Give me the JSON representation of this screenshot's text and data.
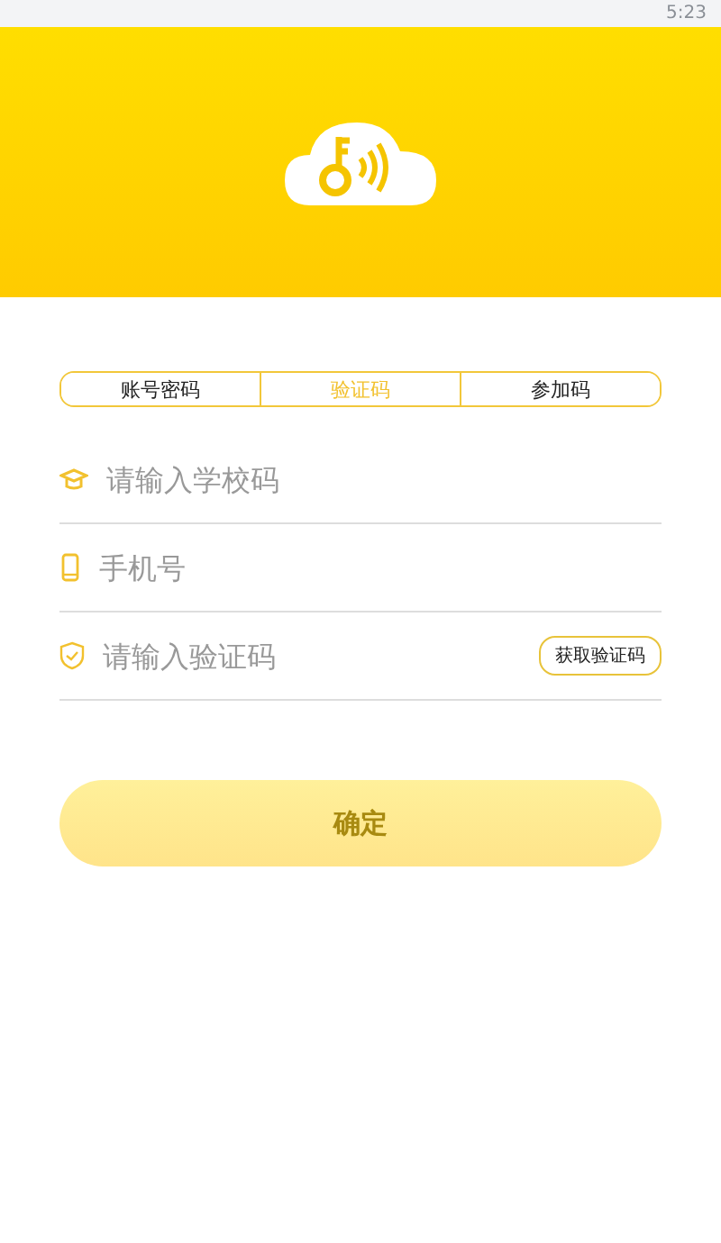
{
  "status_bar": {
    "time": "5:23"
  },
  "tabs": [
    {
      "label": "账号密码",
      "selected": false
    },
    {
      "label": "验证码",
      "selected": true
    },
    {
      "label": "参加码",
      "selected": false
    }
  ],
  "fields": [
    {
      "kind": "school",
      "placeholder": "请输入学校码"
    },
    {
      "kind": "phone",
      "placeholder": "手机号"
    },
    {
      "kind": "code",
      "placeholder": "请输入验证码",
      "action": "获取验证码"
    }
  ],
  "submit": {
    "label": "确定",
    "disabled": true
  }
}
